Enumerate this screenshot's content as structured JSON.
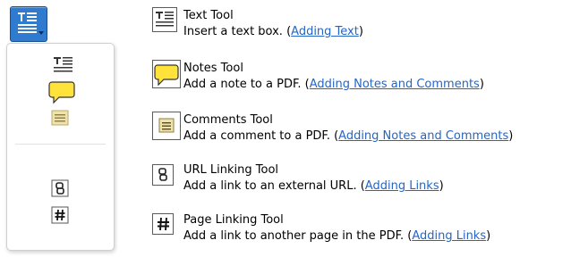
{
  "tools": [
    {
      "id": "text",
      "icon": "text-tool-icon",
      "name": "Text Tool",
      "desc_prefix": "Insert a text box. (",
      "link_text": "Adding Text",
      "desc_suffix": ")"
    },
    {
      "id": "notes",
      "icon": "speech-bubble-icon",
      "name": "Notes Tool",
      "desc_prefix": "Add a note to a PDF. (",
      "link_text": "Adding Notes and Comments",
      "desc_suffix": ")"
    },
    {
      "id": "comments",
      "icon": "comment-note-icon",
      "name": "Comments Tool",
      "desc_prefix": "Add a comment to a PDF. (",
      "link_text": "Adding Notes and Comments",
      "desc_suffix": ")"
    },
    {
      "id": "url",
      "icon": "chain-link-icon",
      "name": "URL Linking Tool",
      "desc_prefix": "Add a link to an external URL. (",
      "link_text": "Adding Links",
      "desc_suffix": ")"
    },
    {
      "id": "page",
      "icon": "hash-icon",
      "name": "Page Linking Tool",
      "desc_prefix": "Add a link to another page in the PDF. (",
      "link_text": "Adding Links",
      "desc_suffix": ")"
    }
  ],
  "colors": {
    "accent": "#2f7bd0",
    "link": "#2366c6",
    "note_yellow": "#ffe23a",
    "comment_beige": "#efe3ad"
  }
}
